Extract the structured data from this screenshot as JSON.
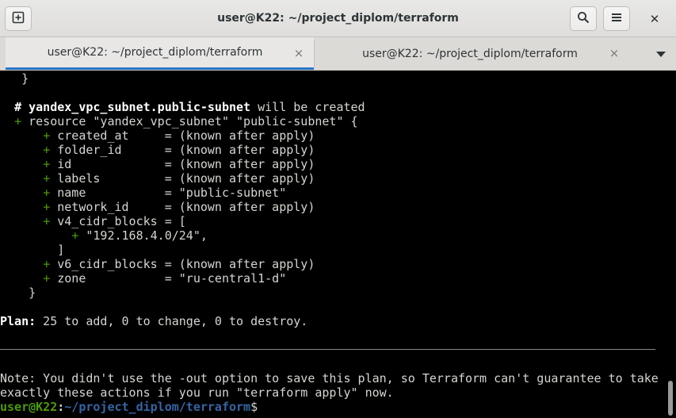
{
  "window": {
    "title": "user@K22: ~/project_diplom/terraform",
    "buttons": {
      "new_tab": "new-tab-icon",
      "search": "search-icon",
      "menu": "hamburger-menu-icon",
      "close": "✕"
    }
  },
  "tabs": [
    {
      "label": "user@K22: ~/project_diplom/terraform",
      "active": true,
      "close": "×"
    },
    {
      "label": "user@K22: ~/project_diplom/terraform",
      "active": false,
      "close": "×"
    }
  ],
  "terminal": {
    "lines": [
      {
        "indent": "   ",
        "text": "}"
      },
      {
        "indent": "",
        "text": ""
      },
      {
        "indent": "  ",
        "comment_hash": "# ",
        "resource_name": "yandex_vpc_subnet.public-subnet",
        "rest": " will be created"
      },
      {
        "indent": "  ",
        "plus": "+",
        "text": " resource \"yandex_vpc_subnet\" \"public-subnet\" {"
      },
      {
        "indent": "      ",
        "plus": "+",
        "text": " created_at     = (known after apply)"
      },
      {
        "indent": "      ",
        "plus": "+",
        "text": " folder_id      = (known after apply)"
      },
      {
        "indent": "      ",
        "plus": "+",
        "text": " id             = (known after apply)"
      },
      {
        "indent": "      ",
        "plus": "+",
        "text": " labels         = (known after apply)"
      },
      {
        "indent": "      ",
        "plus": "+",
        "text": " name           = \"public-subnet\""
      },
      {
        "indent": "      ",
        "plus": "+",
        "text": " network_id     = (known after apply)"
      },
      {
        "indent": "      ",
        "plus": "+",
        "text": " v4_cidr_blocks = ["
      },
      {
        "indent": "          ",
        "plus": "+",
        "text": " \"192.168.4.0/24\","
      },
      {
        "indent": "        ",
        "text": "]"
      },
      {
        "indent": "      ",
        "plus": "+",
        "text": " v6_cidr_blocks = (known after apply)"
      },
      {
        "indent": "      ",
        "plus": "+",
        "text": " zone           = \"ru-central1-d\""
      },
      {
        "indent": "    ",
        "text": "}"
      }
    ],
    "plan_label": "Plan:",
    "plan_text": " 25 to add, 0 to change, 0 to destroy.",
    "note_line1": "Note: You didn't use the -out option to save this plan, so Terraform can't guarantee to take",
    "note_line2": "exactly these actions if you run \"terraform apply\" now.",
    "prompt_user": "user@K22",
    "prompt_sep": ":",
    "prompt_path": "~/project_diplom/terraform",
    "prompt_symbol": "$"
  }
}
